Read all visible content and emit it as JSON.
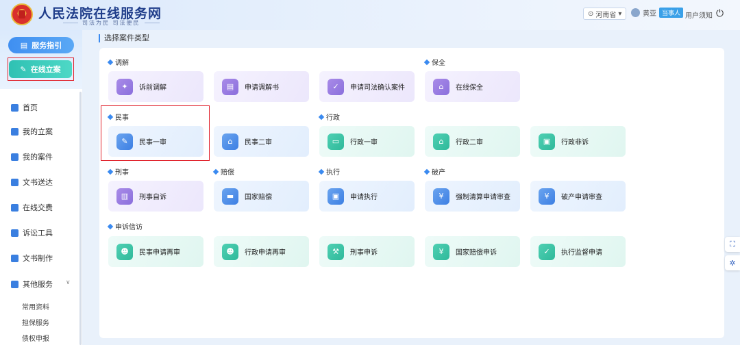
{
  "header": {
    "site_title": "人民法院在线服务网",
    "slogan": "司法为民  司法便民",
    "region": "河南省",
    "user_name": "黄亚",
    "role_badge": "当事人",
    "notice": "用户须知"
  },
  "sidebar": {
    "guide_button": "服务指引",
    "filing_button": "在线立案",
    "nav": [
      "首页",
      "我的立案",
      "我的案件",
      "文书送达",
      "在线交费",
      "诉讼工具",
      "文书制作",
      "其他服务"
    ],
    "sub_items": [
      "常用资料",
      "担保服务",
      "债权申报"
    ]
  },
  "main": {
    "title": "选择案件类型",
    "groups": {
      "mediation": "调解",
      "preservation": "保全",
      "civil": "民事",
      "admin": "行政",
      "criminal": "刑事",
      "compensation": "赔偿",
      "execution": "执行",
      "bankruptcy": "破产",
      "petition": "申诉信访"
    },
    "cards": {
      "pre_mediation": "诉前调解",
      "mediation_letter": "申请调解书",
      "judicial_confirm": "申请司法确认案件",
      "online_preservation": "在线保全",
      "civil_first": "民事一审",
      "civil_second": "民事二审",
      "admin_first": "行政一审",
      "admin_second": "行政二审",
      "admin_non_litigation": "行政非诉",
      "criminal_private": "刑事自诉",
      "state_compensation": "国家赔偿",
      "apply_execution": "申请执行",
      "forced_liquidation": "强制清算申请审查",
      "bankruptcy_review": "破产申请审查",
      "civil_retrial": "民事申请再审",
      "admin_retrial": "行政申请再审",
      "criminal_appeal": "刑事申诉",
      "state_comp_appeal": "国家赔偿申诉",
      "execution_supervision": "执行监督申请"
    }
  }
}
